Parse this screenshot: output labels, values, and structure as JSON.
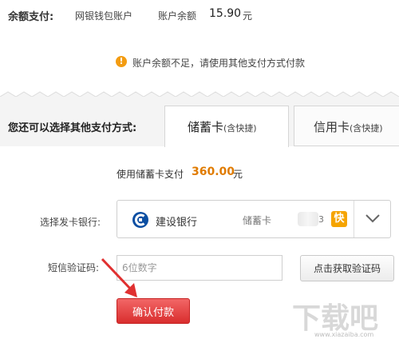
{
  "balance": {
    "label": "余额支付:",
    "account": "网银钱包账户",
    "text": "账户余额",
    "amount": "15.90",
    "currency": "元"
  },
  "warning": {
    "icon": "!",
    "text": "账户余额不足，请使用其他支付方式付款"
  },
  "other_methods": {
    "label": "您还可以选择其他支付方式:",
    "tabs": [
      {
        "label": "储蓄卡",
        "sub": "(含快捷)",
        "active": true
      },
      {
        "label": "信用卡",
        "sub": "(含快捷)",
        "active": false
      }
    ]
  },
  "payment": {
    "text": "使用储蓄卡支付",
    "amount": "360.00",
    "currency": "元",
    "amount_color": "#e07b00"
  },
  "bank_select": {
    "label": "选择发卡银行:",
    "bank_name": "建设银行",
    "card_type": "储蓄卡",
    "card_digit": "3",
    "quick_badge": "快",
    "logo_icon": "ccb-logo-icon",
    "dropdown_icon": "chevron-down-icon"
  },
  "sms": {
    "label": "短信验证码:",
    "placeholder": "6位数字",
    "value": "",
    "get_code_button": "点击获取验证码"
  },
  "confirm": {
    "label": "确认付款",
    "color": "#e03a3a"
  },
  "watermark": {
    "text": "下载吧",
    "url": "www.xiazaiba.com"
  }
}
